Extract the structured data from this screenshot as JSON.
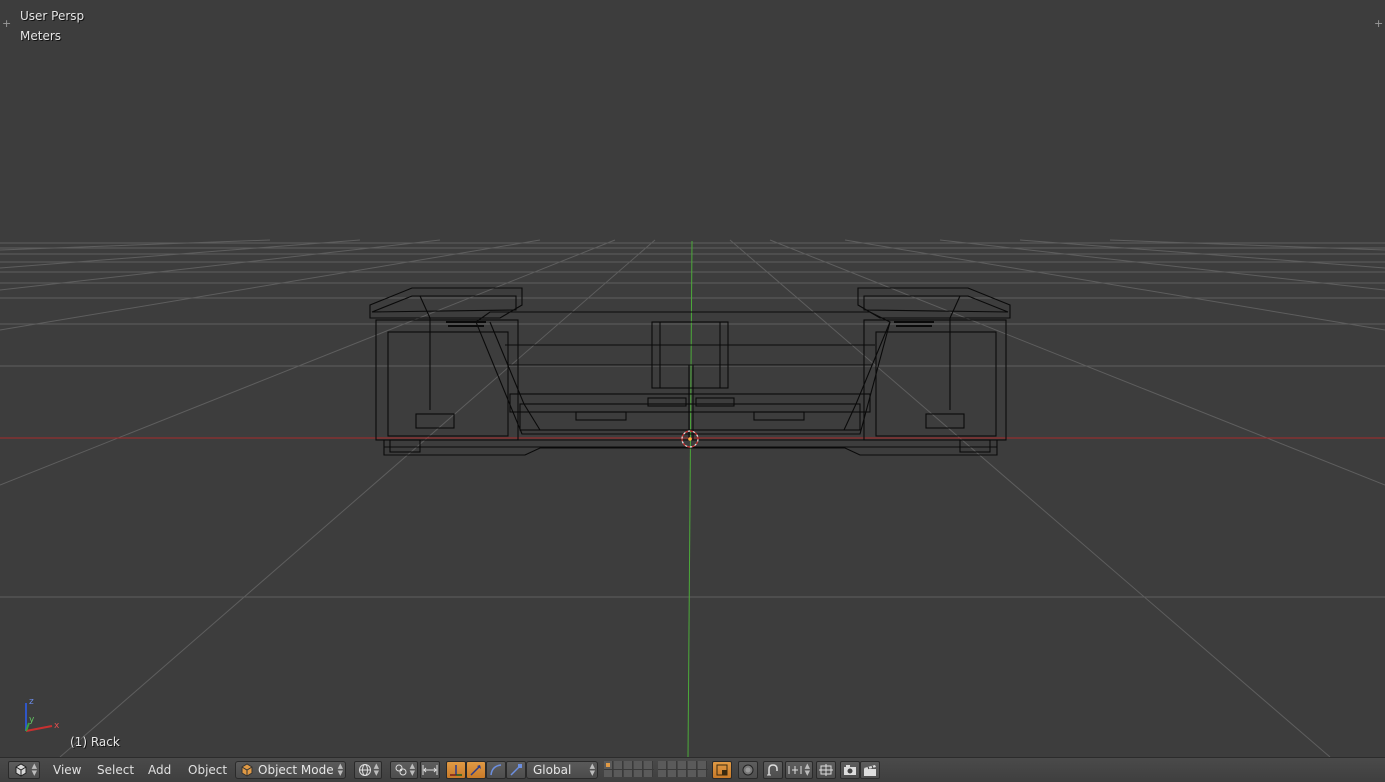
{
  "viewport": {
    "view_name": "User Persp",
    "units": "Meters",
    "object_info": "(1) Rack",
    "axis_labels": {
      "z": "z",
      "y": "y",
      "x": "x"
    },
    "colors": {
      "background": "#3d3d3d",
      "grid": "#5c5c5c",
      "x_axis": "#a82a2a",
      "y_axis": "#4caa3a",
      "wire": "#0a0a0a"
    }
  },
  "header": {
    "menus": {
      "view": "View",
      "select": "Select",
      "add": "Add",
      "object": "Object"
    },
    "mode": {
      "value": "Object Mode",
      "icon": "cube-icon"
    },
    "orientation": {
      "value": "Global"
    },
    "icons": [
      "editor-type-icon",
      "viewport-shading-icon",
      "pivot-point-icon",
      "manipulator-toggle-icon",
      "translate-manipulator-icon",
      "rotate-manipulator-icon",
      "scale-manipulator-icon",
      "layers-icon",
      "lock-camera-icon",
      "proportional-edit-icon",
      "snap-icon",
      "snap-target-icon",
      "render-opengl-icon",
      "render-animation-icon"
    ]
  }
}
